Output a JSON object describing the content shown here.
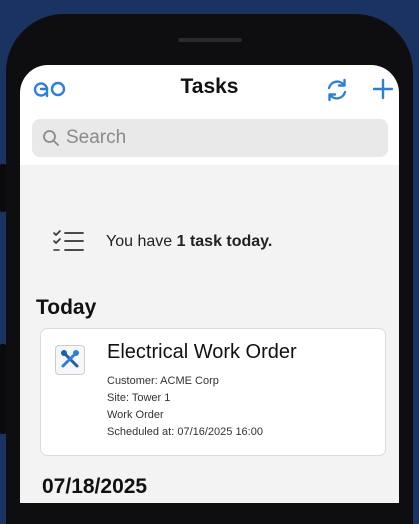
{
  "header": {
    "title": "Tasks",
    "logo_icon": "go-logo-icon",
    "refresh_icon": "refresh-icon",
    "add_icon": "plus-icon",
    "accent_color": "#2f7fd6"
  },
  "search": {
    "placeholder": "Search"
  },
  "summary": {
    "prefix": "You have ",
    "count_text": "1 task today.",
    "icon": "checklist-icon"
  },
  "sections": {
    "today_label": "Today",
    "next_label": "07/18/2025"
  },
  "task": {
    "title": "Electrical Work Order",
    "customer": "Customer: ACME Corp",
    "site": "Site: Tower 1",
    "type": "Work Order",
    "scheduled": "Scheduled at: 07/16/2025 16:00",
    "icon": "tools-icon"
  }
}
